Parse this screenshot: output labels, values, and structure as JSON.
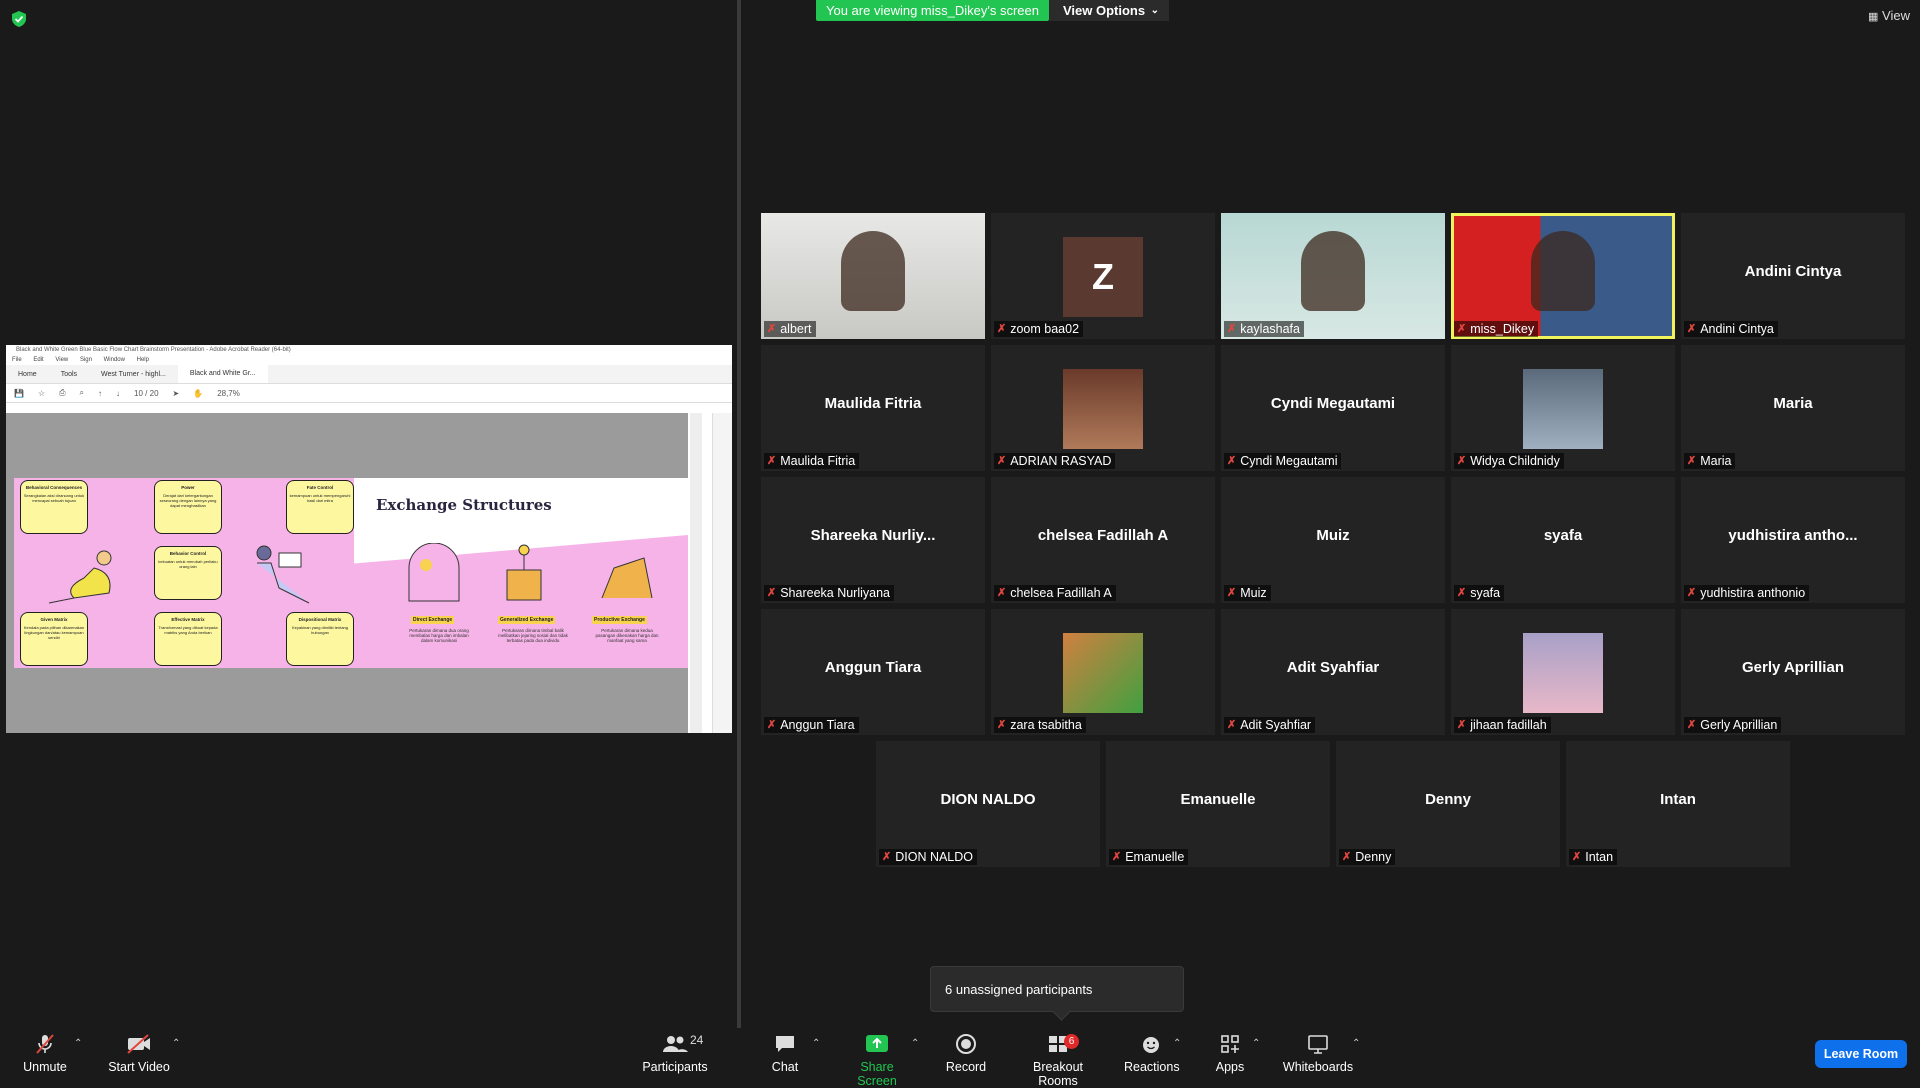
{
  "banner": {
    "viewing_text": "You are viewing miss_Dikey's screen",
    "view_options_label": "View Options"
  },
  "top_right": {
    "view_label": "View"
  },
  "shared_screen": {
    "window_title": "Black and White Green Blue Basic Flow Chart Brainstorm Presentation - Adobe Acrobat Reader (64-bit)",
    "menu": [
      "File",
      "Edit",
      "View",
      "Sign",
      "Window",
      "Help"
    ],
    "tabs": [
      "Home",
      "Tools",
      "West Turner - highl...",
      "Black and White Gr..."
    ],
    "page_current": "10",
    "page_total": "/ 20",
    "zoom": "28,7%",
    "slide_title": "Exchange Structures",
    "cards": [
      {
        "title": "Behavioral Consequences",
        "text": "Serangkaian aksi dirancang untuk mencapai sebuah tujuan"
      },
      {
        "title": "Power",
        "text": "Derajat dari ketergantungan seseorang dengan lainnya yang dapat menghasilkan"
      },
      {
        "title": "Fate Control",
        "text": "kemampuan untuk mempengaruhi hasil dari mitra"
      },
      {
        "title": "Behavior Control",
        "text": "kekuatan untuk merubah perilaku orang lain"
      },
      {
        "title": "Given Matrix",
        "text": "Kendala pada pilihan dikarenakan lingkungan dan/atau kemampuan sendiri"
      },
      {
        "title": "Effective Matrix",
        "text": "Transformasi yang dibuat kepada matriks yang Anda berikan"
      },
      {
        "title": "Dispositional Matrix",
        "text": "Keyakinan yang dimiliki tentang hubungan"
      }
    ],
    "exchanges": [
      {
        "label": "Direct Exchange",
        "desc": "Pertukaran dimana dua orang membalas harga dan imbalan dalam komunikasi"
      },
      {
        "label": "Generalized Exchange",
        "desc": "Pertukaran dimana timbal balik melibatkan jejaring sosial dan tidak terbatas pada dua individu"
      },
      {
        "label": "Productive Exchange",
        "desc": "Pertukaran dimana kedua pasangan dikenakan harga dan manfaat yang sama"
      }
    ]
  },
  "participants": [
    {
      "name": "albert",
      "display": "",
      "type": "video"
    },
    {
      "name": "zoom baa02",
      "display": "Z",
      "type": "avatar"
    },
    {
      "name": "kaylashafa",
      "display": "",
      "type": "video"
    },
    {
      "name": "miss_Dikey",
      "display": "",
      "type": "video",
      "speaking": true
    },
    {
      "name": "Andini Cintya",
      "display": "Andini Cintya",
      "type": "name"
    },
    {
      "name": "Maulida Fitria",
      "display": "Maulida Fitria",
      "type": "name"
    },
    {
      "name": "ADRIAN RASYAD",
      "display": "",
      "type": "photo"
    },
    {
      "name": "Cyndi Megautami",
      "display": "Cyndi Megautami",
      "type": "name"
    },
    {
      "name": "Widya Childnidy",
      "display": "",
      "type": "photo"
    },
    {
      "name": "Maria",
      "display": "Maria",
      "type": "name"
    },
    {
      "name": "Shareeka Nurliyana",
      "display": "Shareeka  Nurliy...",
      "type": "name"
    },
    {
      "name": "chelsea Fadillah A",
      "display": "chelsea Fadillah A",
      "type": "name"
    },
    {
      "name": "Muiz",
      "display": "Muiz",
      "type": "name"
    },
    {
      "name": "syafa",
      "display": "syafa",
      "type": "name"
    },
    {
      "name": "yudhistira anthonio",
      "display": "yudhistira  antho...",
      "type": "name"
    },
    {
      "name": "Anggun Tiara",
      "display": "Anggun Tiara",
      "type": "name"
    },
    {
      "name": "zara tsabitha",
      "display": "",
      "type": "photo"
    },
    {
      "name": "Adit Syahfiar",
      "display": "Adit Syahfiar",
      "type": "name"
    },
    {
      "name": "jihaan fadillah",
      "display": "",
      "type": "photo"
    },
    {
      "name": "Gerly Aprillian",
      "display": "Gerly Aprillian",
      "type": "name"
    },
    {
      "name": "DION NALDO",
      "display": "DION NALDO",
      "type": "name"
    },
    {
      "name": "Emanuelle",
      "display": "Emanuelle",
      "type": "name"
    },
    {
      "name": "Denny",
      "display": "Denny",
      "type": "name"
    },
    {
      "name": "Intan",
      "display": "Intan",
      "type": "name"
    }
  ],
  "toast": {
    "text": "6 unassigned participants"
  },
  "toolbar": {
    "unmute": "Unmute",
    "start_video": "Start Video",
    "participants": "Participants",
    "participants_count": "24",
    "chat": "Chat",
    "share_screen": "Share Screen",
    "record": "Record",
    "breakout_rooms": "Breakout Rooms",
    "breakout_badge": "6",
    "reactions": "Reactions",
    "apps": "Apps",
    "whiteboards": "Whiteboards",
    "leave_room": "Leave Room"
  },
  "colors": {
    "share_green": "#23c552",
    "leave_blue": "#0e71eb",
    "speaking": "#f1f35b",
    "muted_red": "#e0473e"
  }
}
